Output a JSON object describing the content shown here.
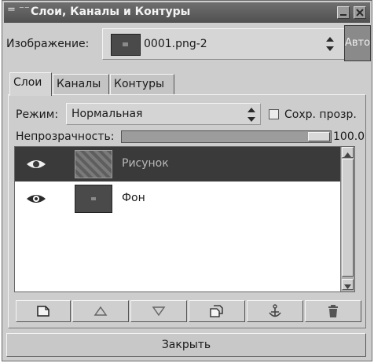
{
  "window": {
    "title": "Слои, Каналы и Контуры",
    "menu_glyph": "= ⁻⁻"
  },
  "image_row": {
    "label": "Изображение:",
    "selected_image": "0001.png-2",
    "auto_label": "Авто"
  },
  "tabs": [
    {
      "label": "Слои",
      "active": true
    },
    {
      "label": "Каналы",
      "active": false
    },
    {
      "label": "Контуры",
      "active": false
    }
  ],
  "mode": {
    "label": "Режим:",
    "value": "Нормальная"
  },
  "keep_transparency": {
    "label": "Сохр. прозр.",
    "checked": false
  },
  "opacity": {
    "label": "Непрозрачность:",
    "value": "100.0",
    "fraction": 1.0
  },
  "layers": [
    {
      "name": "Рисунок",
      "visible": true,
      "selected": true
    },
    {
      "name": "Фон",
      "visible": true,
      "selected": false
    }
  ],
  "actions": [
    {
      "icon": "new-layer-icon"
    },
    {
      "icon": "raise-layer-icon"
    },
    {
      "icon": "lower-layer-icon"
    },
    {
      "icon": "duplicate-layer-icon"
    },
    {
      "icon": "anchor-icon"
    },
    {
      "icon": "trash-icon"
    }
  ],
  "close_label": "Закрыть",
  "colors": {
    "title_bar": "#5e5e5e",
    "selected_row": "#3a3a3a",
    "window_bg": "#cdcdcd"
  }
}
